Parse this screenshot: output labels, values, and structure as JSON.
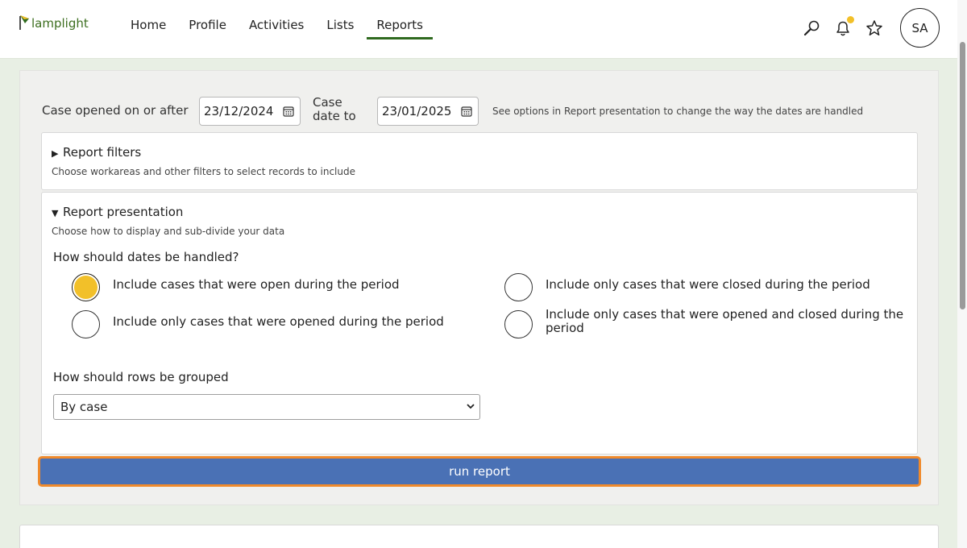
{
  "app": {
    "logo_text": "lamplight"
  },
  "nav": {
    "items": [
      {
        "label": "Home"
      },
      {
        "label": "Profile"
      },
      {
        "label": "Activities"
      },
      {
        "label": "Lists"
      },
      {
        "label": "Reports",
        "active": true
      }
    ]
  },
  "header": {
    "avatar_initials": "SA",
    "notification_dot_color": "#f2c029"
  },
  "dates": {
    "opened_label": "Case opened on or after",
    "opened_value": "23/12/2024",
    "to_label_line1": "Case",
    "to_label_line2": "date to",
    "to_value": "23/01/2025",
    "note": "See options in Report presentation to change the way the dates are handled"
  },
  "filters": {
    "title": "Report filters",
    "subtitle": "Choose workareas and other filters to select records to include",
    "expanded": false
  },
  "presentation": {
    "title": "Report presentation",
    "subtitle": "Choose how to display and sub-divide your data",
    "expanded": true,
    "dates_question": "How should dates be handled?",
    "options": [
      {
        "label": "Include cases that were open during the period",
        "checked": true
      },
      {
        "label": "Include only cases that were closed during the period",
        "checked": false
      },
      {
        "label": "Include only cases that were opened during the period",
        "checked": false
      },
      {
        "label": "Include only cases that were opened and closed during the period",
        "checked": false
      }
    ],
    "grouping_question": "How should rows be grouped",
    "grouping_selected": "By case"
  },
  "actions": {
    "run_label": "run report"
  },
  "colors": {
    "accent_green": "#2f6a1f",
    "button_blue": "#4a71b5",
    "focus_orange": "#f08a2b",
    "radio_selected": "#f2c029"
  }
}
